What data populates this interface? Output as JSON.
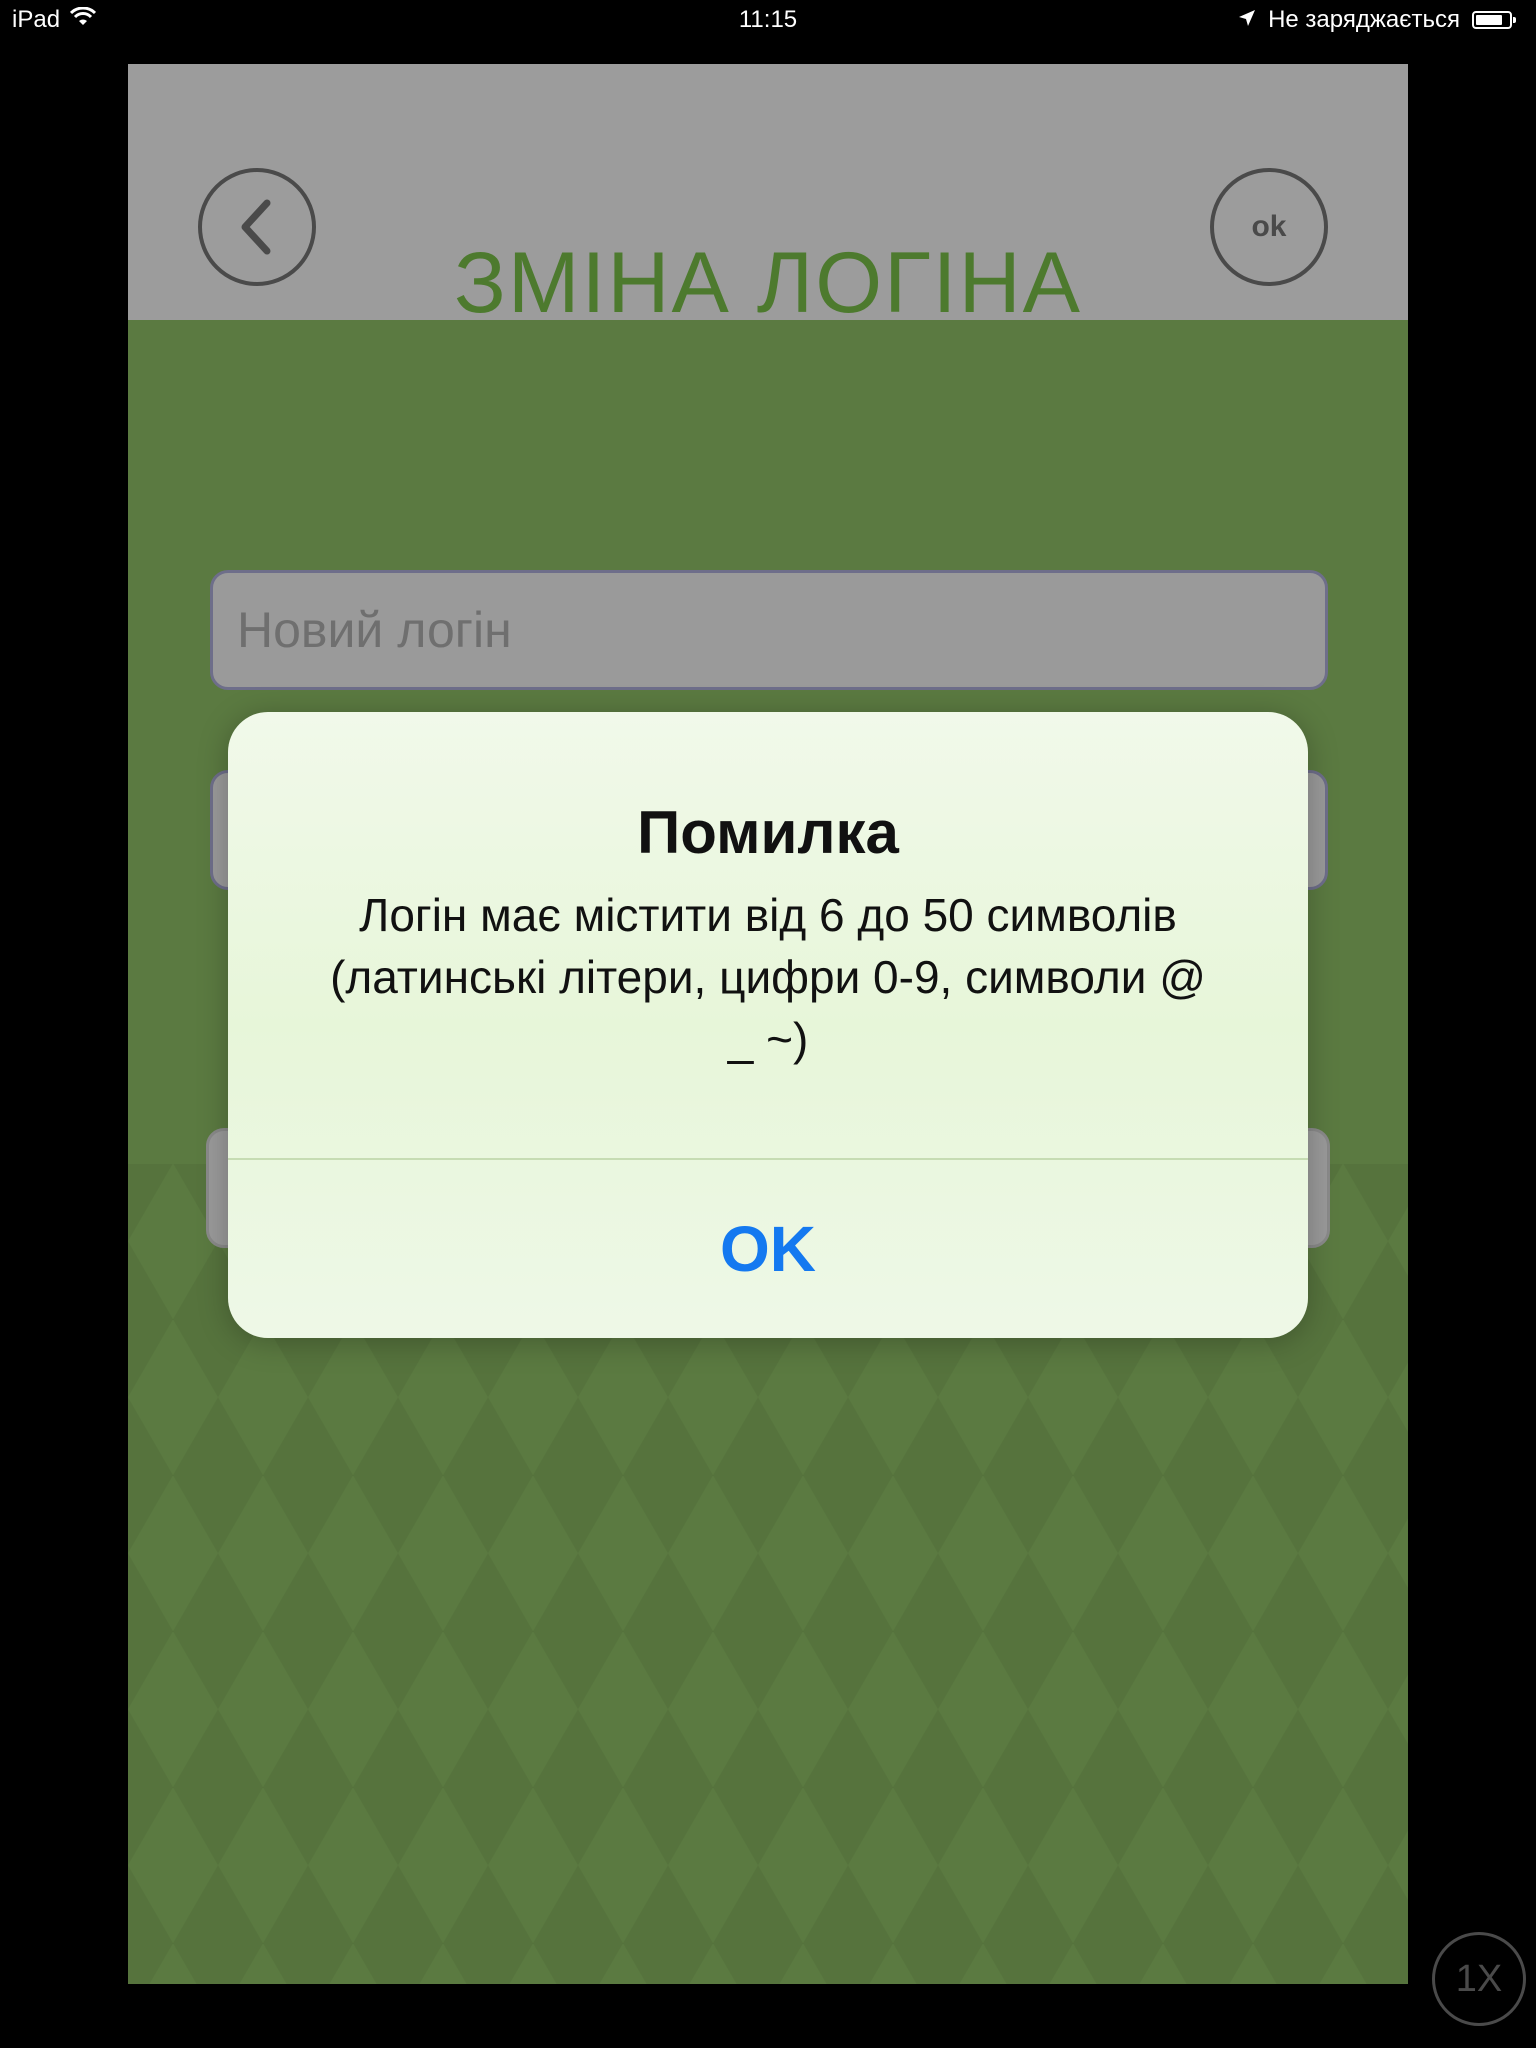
{
  "status_bar": {
    "device": "iPad",
    "time": "11:15",
    "battery_text": "Не заряджається"
  },
  "header": {
    "title": "ЗМІНА ЛОГІНА",
    "ok_label": "ok"
  },
  "form": {
    "login_placeholder": "Новий логін"
  },
  "alert": {
    "title": "Помилка",
    "message": "Логін має містити від 6 до 50 символів (латинські літери, цифри 0-9, символи  @ _ ~)",
    "ok_label": "OK"
  },
  "zoom": {
    "label": "1X"
  },
  "colors": {
    "background": "#5b7a41",
    "header_bg": "#9c9c9c",
    "title": "#4d7a2e",
    "alert_button": "#1479f0"
  }
}
